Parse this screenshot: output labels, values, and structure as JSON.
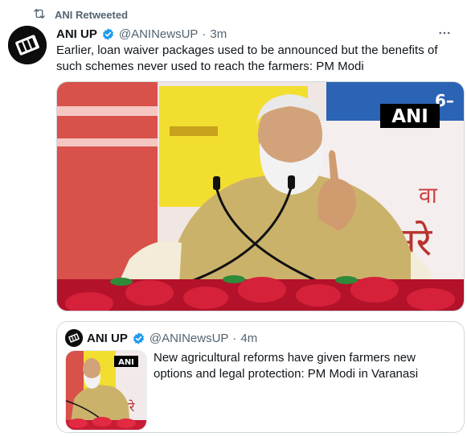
{
  "retweet": {
    "label": "ANI Retweeted"
  },
  "tweet": {
    "name": "ANI UP",
    "handle": "@ANINewsUP",
    "separator": "·",
    "time": "3m",
    "text": "Earlier, loan waiver packages used to be announced but the benefits of such schemes never used to reach the farmers: PM Modi",
    "media": {
      "watermark": "ANI",
      "banner_text": "6–"
    }
  },
  "quote": {
    "name": "ANI UP",
    "handle": "@ANINewsUP",
    "separator": "·",
    "time": "4m",
    "text": "New agricultural reforms have given farmers new options and  legal protection: PM Modi in Varanasi",
    "media": {
      "watermark": "ANI"
    }
  },
  "colors": {
    "verified": "#1d9bf0",
    "secondary_text": "#536471",
    "border": "#cfd9de"
  },
  "icons": [
    "retweet-icon",
    "verified-icon",
    "more-icon"
  ]
}
